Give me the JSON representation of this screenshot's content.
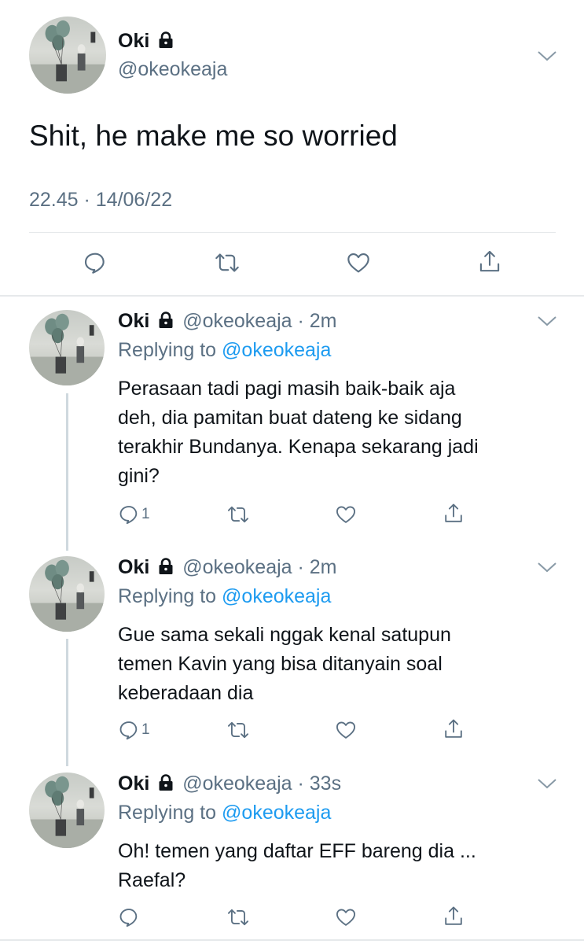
{
  "main_tweet": {
    "display_name": "Oki",
    "handle": "@okeokeaja",
    "text": "Shit, he make me so worried",
    "timestamp": "22.45 · 14/06/22",
    "icons": [
      "reply-icon",
      "retweet-icon",
      "like-icon",
      "share-icon"
    ]
  },
  "replies": [
    {
      "display_name": "Oki",
      "handle_time": "@okeokeaja · 2m",
      "replying_prefix": "Replying to",
      "replying_to": "@okeokeaja",
      "lines": [
        "Perasaan tadi pagi masih baik-baik aja",
        "deh, dia pamitan buat dateng ke sidang",
        "terakhir Bundanya. Kenapa sekarang jadi",
        "gini?"
      ],
      "reply_count": "1"
    },
    {
      "display_name": "Oki",
      "handle_time": "@okeokeaja · 2m",
      "replying_prefix": "Replying to",
      "replying_to": "@okeokeaja",
      "lines": [
        "Gue sama sekali nggak kenal satupun",
        "temen Kavin yang bisa ditanyain soal",
        "keberadaan dia"
      ],
      "reply_count": "1"
    },
    {
      "display_name": "Oki",
      "handle_time": "@okeokeaja · 33s",
      "replying_prefix": "Replying to",
      "replying_to": "@okeokeaja",
      "lines": [
        "Oh! temen yang daftar EFF bareng dia ...",
        "Raefal?"
      ],
      "reply_count": ""
    }
  ],
  "colors": {
    "text": "#0f1419",
    "secondary": "#5b7083",
    "link": "#1d9bf0",
    "divider": "#e6e9eb"
  }
}
